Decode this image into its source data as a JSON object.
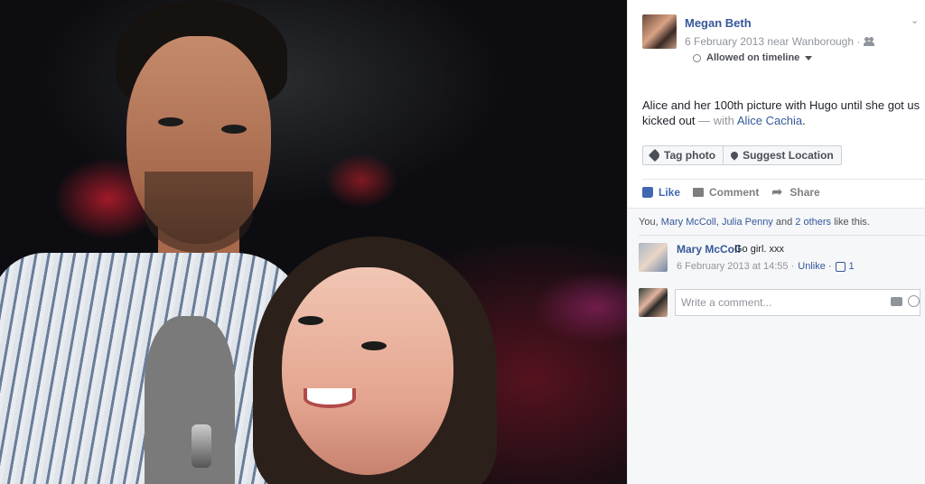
{
  "post": {
    "author": "Megan Beth",
    "date_location": "6 February 2013 near Wanborough ·",
    "privacy_icon": "people-icon",
    "timeline_status": "Allowed on timeline",
    "caption_text": "Alice and her 100th picture with Hugo until she got us kicked out",
    "caption_with": "— with",
    "tagged_person": "Alice Cachia"
  },
  "tag_buttons": {
    "tag_photo": "Tag photo",
    "suggest_location": "Suggest Location"
  },
  "actions": {
    "like": "Like",
    "comment": "Comment",
    "share": "Share"
  },
  "likes": {
    "prefix": "You,",
    "person1": "Mary McColl",
    "sep": ",",
    "person2": "Julia Penny",
    "and": "and",
    "others": "2 others",
    "suffix": "like this."
  },
  "comment": {
    "name": "Mary McColl",
    "text": "Go girl. xxx",
    "time": "6 February 2013 at 14:55 ·",
    "unlike": "Unlike ·",
    "like_count": "1"
  },
  "composer": {
    "placeholder": "Write a comment..."
  },
  "colors": {
    "link": "#365899",
    "like_active": "#4267b2",
    "meta_gray": "#90949c"
  }
}
